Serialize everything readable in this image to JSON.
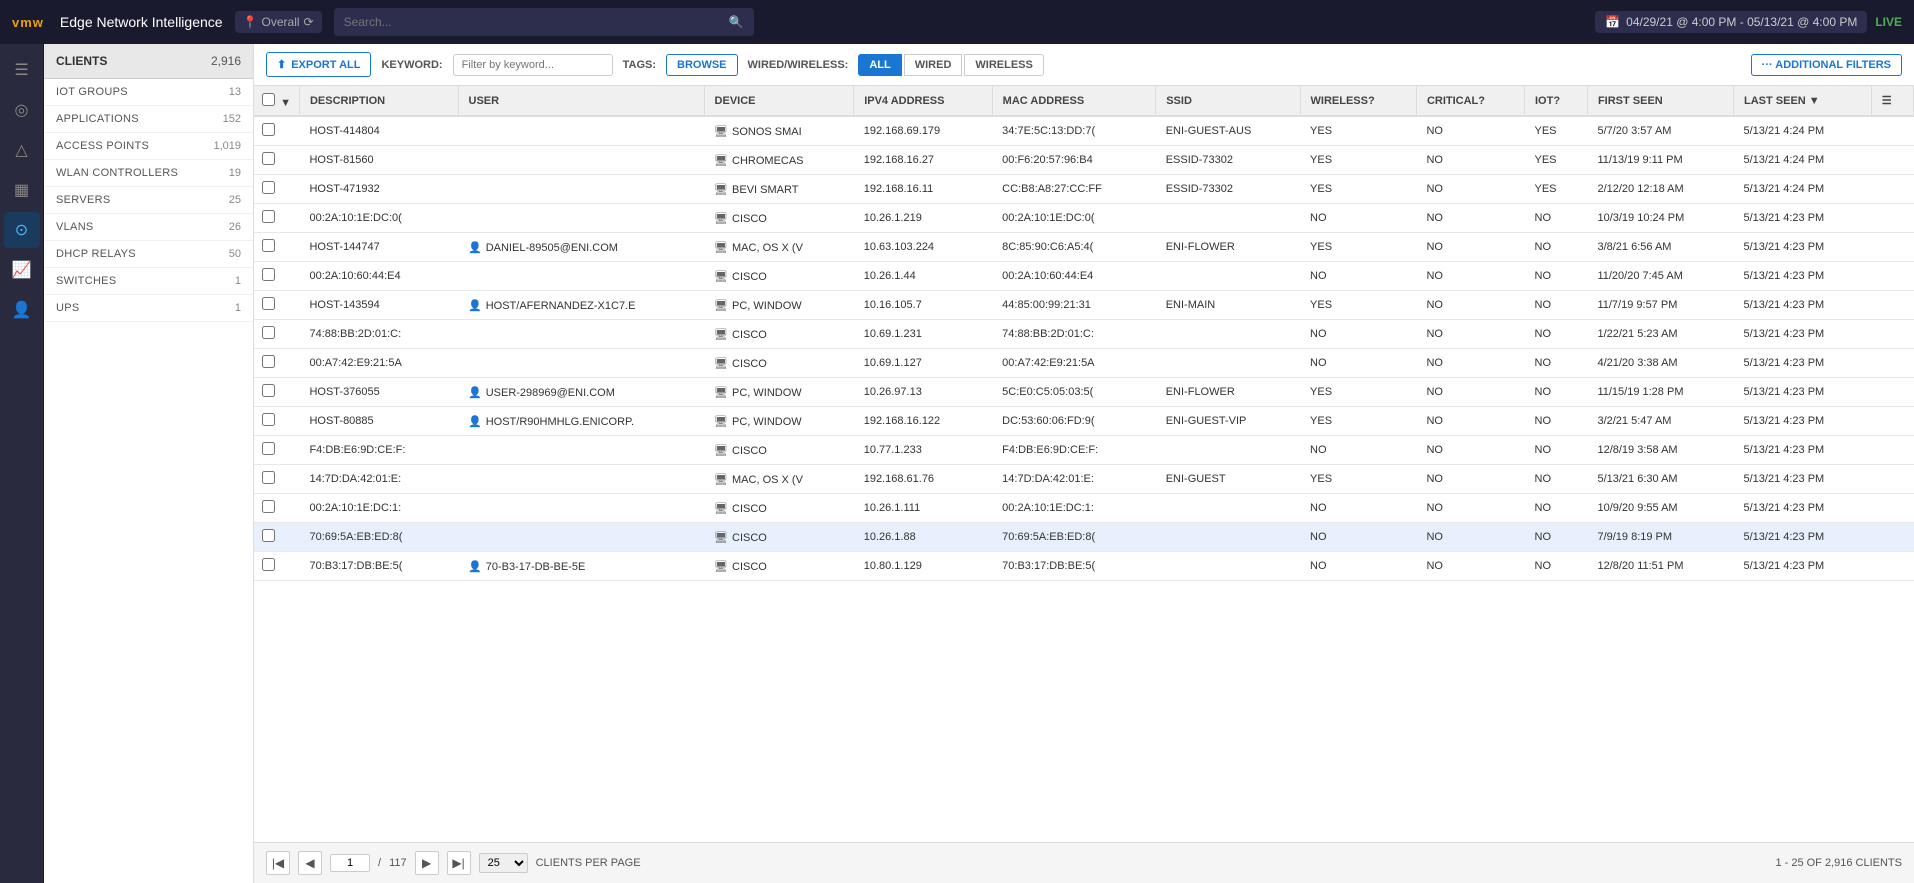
{
  "topbar": {
    "logo": "vmw",
    "title": "Edge Network Intelligence",
    "location": "Overall",
    "search_placeholder": "Search...",
    "date_range": "04/29/21 @ 4:00 PM - 05/13/21 @ 4:00 PM",
    "live_label": "LIVE"
  },
  "icon_sidebar": {
    "items": [
      {
        "name": "menu-icon",
        "symbol": "☰"
      },
      {
        "name": "location-icon",
        "symbol": "◎"
      },
      {
        "name": "alert-icon",
        "symbol": "△"
      },
      {
        "name": "chart-icon",
        "symbol": "📶"
      },
      {
        "name": "target-icon",
        "symbol": "⊙",
        "active": true
      },
      {
        "name": "analytics-icon",
        "symbol": "📈"
      },
      {
        "name": "user-icon",
        "symbol": "👤"
      },
      {
        "name": "help-icon",
        "symbol": "?"
      }
    ]
  },
  "left_panel": {
    "header": "CLIENTS",
    "total": "2,916",
    "groups": [
      {
        "label": "IOT GROUPS",
        "count": "13"
      },
      {
        "label": "APPLICATIONS",
        "count": "152"
      },
      {
        "label": "ACCESS POINTS",
        "count": "1,019"
      },
      {
        "label": "WLAN CONTROLLERS",
        "count": "19"
      },
      {
        "label": "SERVERS",
        "count": "25"
      },
      {
        "label": "VLANS",
        "count": "26"
      },
      {
        "label": "DHCP RELAYS",
        "count": "50"
      },
      {
        "label": "SWITCHES",
        "count": "1"
      },
      {
        "label": "UPS",
        "count": "1"
      }
    ]
  },
  "filter_bar": {
    "export_label": "EXPORT ALL",
    "keyword_label": "KEYWORD:",
    "keyword_placeholder": "Filter by keyword...",
    "tags_label": "TAGS:",
    "browse_label": "BROWSE",
    "wired_wireless_label": "WIRED/WIRELESS:",
    "filter_buttons": [
      "ALL",
      "WIRED",
      "WIRELESS"
    ],
    "active_filter": "ALL",
    "additional_filters_label": "··· ADDITIONAL FILTERS"
  },
  "table": {
    "columns": [
      {
        "id": "description",
        "label": "DESCRIPTION"
      },
      {
        "id": "user",
        "label": "USER"
      },
      {
        "id": "device",
        "label": "DEVICE"
      },
      {
        "id": "ipv4",
        "label": "IPV4 ADDRESS"
      },
      {
        "id": "mac",
        "label": "MAC ADDRESS"
      },
      {
        "id": "ssid",
        "label": "SSID"
      },
      {
        "id": "wireless",
        "label": "WIRELESS?"
      },
      {
        "id": "critical",
        "label": "CRITICAL?"
      },
      {
        "id": "iot",
        "label": "IOT?"
      },
      {
        "id": "first_seen",
        "label": "FIRST SEEN"
      },
      {
        "id": "last_seen",
        "label": "LAST SEEN",
        "sortable": true
      }
    ],
    "rows": [
      {
        "description": "HOST-414804",
        "user": "",
        "has_user": false,
        "device": "SONOS SMAI",
        "ipv4": "192.168.69.179",
        "mac": "34:7E:5C:13:DD:7(",
        "ssid": "ENI-GUEST-AUS",
        "wireless": "YES",
        "critical": "NO",
        "iot": "YES",
        "first_seen": "5/7/20 3:57 AM",
        "last_seen": "5/13/21 4:24 PM",
        "highlighted": false
      },
      {
        "description": "HOST-81560",
        "user": "",
        "has_user": false,
        "device": "CHROMECAS",
        "ipv4": "192.168.16.27",
        "mac": "00:F6:20:57:96:B4",
        "ssid": "ESSID-73302",
        "wireless": "YES",
        "critical": "NO",
        "iot": "YES",
        "first_seen": "11/13/19 9:11 PM",
        "last_seen": "5/13/21 4:24 PM",
        "highlighted": false
      },
      {
        "description": "HOST-471932",
        "user": "",
        "has_user": false,
        "device": "BEVI SMART",
        "ipv4": "192.168.16.11",
        "mac": "CC:B8:A8:27:CC:FF",
        "ssid": "ESSID-73302",
        "wireless": "YES",
        "critical": "NO",
        "iot": "YES",
        "first_seen": "2/12/20 12:18 AM",
        "last_seen": "5/13/21 4:24 PM",
        "highlighted": false
      },
      {
        "description": "00:2A:10:1E:DC:0(",
        "user": "",
        "has_user": false,
        "device": "CISCO",
        "ipv4": "10.26.1.219",
        "mac": "00:2A:10:1E:DC:0(",
        "ssid": "",
        "wireless": "NO",
        "critical": "NO",
        "iot": "NO",
        "first_seen": "10/3/19 10:24 PM",
        "last_seen": "5/13/21 4:23 PM",
        "highlighted": false
      },
      {
        "description": "HOST-144747",
        "user": "DANIEL-89505@ENI.COM",
        "has_user": true,
        "device": "MAC, OS X (V",
        "ipv4": "10.63.103.224",
        "mac": "8C:85:90:C6:A5:4(",
        "ssid": "ENI-FLOWER",
        "wireless": "YES",
        "critical": "NO",
        "iot": "NO",
        "first_seen": "3/8/21 6:56 AM",
        "last_seen": "5/13/21 4:23 PM",
        "highlighted": false
      },
      {
        "description": "00:2A:10:60:44:E4",
        "user": "",
        "has_user": false,
        "device": "CISCO",
        "ipv4": "10.26.1.44",
        "mac": "00:2A:10:60:44:E4",
        "ssid": "",
        "wireless": "NO",
        "critical": "NO",
        "iot": "NO",
        "first_seen": "11/20/20 7:45 AM",
        "last_seen": "5/13/21 4:23 PM",
        "highlighted": false
      },
      {
        "description": "HOST-143594",
        "user": "HOST/AFERNANDEZ-X1C7.E",
        "has_user": true,
        "device": "PC, WINDOW",
        "ipv4": "10.16.105.7",
        "mac": "44:85:00:99:21:31",
        "ssid": "ENI-MAIN",
        "wireless": "YES",
        "critical": "NO",
        "iot": "NO",
        "first_seen": "11/7/19 9:57 PM",
        "last_seen": "5/13/21 4:23 PM",
        "highlighted": false
      },
      {
        "description": "74:88:BB:2D:01:C:",
        "user": "",
        "has_user": false,
        "device": "CISCO",
        "ipv4": "10.69.1.231",
        "mac": "74:88:BB:2D:01:C:",
        "ssid": "",
        "wireless": "NO",
        "critical": "NO",
        "iot": "NO",
        "first_seen": "1/22/21 5:23 AM",
        "last_seen": "5/13/21 4:23 PM",
        "highlighted": false
      },
      {
        "description": "00:A7:42:E9:21:5A",
        "user": "",
        "has_user": false,
        "device": "CISCO",
        "ipv4": "10.69.1.127",
        "mac": "00:A7:42:E9:21:5A",
        "ssid": "",
        "wireless": "NO",
        "critical": "NO",
        "iot": "NO",
        "first_seen": "4/21/20 3:38 AM",
        "last_seen": "5/13/21 4:23 PM",
        "highlighted": false
      },
      {
        "description": "HOST-376055",
        "user": "USER-298969@ENI.COM",
        "has_user": true,
        "device": "PC, WINDOW",
        "ipv4": "10.26.97.13",
        "mac": "5C:E0:C5:05:03:5(",
        "ssid": "ENI-FLOWER",
        "wireless": "YES",
        "critical": "NO",
        "iot": "NO",
        "first_seen": "11/15/19 1:28 PM",
        "last_seen": "5/13/21 4:23 PM",
        "highlighted": false
      },
      {
        "description": "HOST-80885",
        "user": "HOST/R90HMHLG.ENICORP.",
        "has_user": true,
        "device": "PC, WINDOW",
        "ipv4": "192.168.16.122",
        "mac": "DC:53:60:06:FD:9(",
        "ssid": "ENI-GUEST-VIP",
        "wireless": "YES",
        "critical": "NO",
        "iot": "NO",
        "first_seen": "3/2/21 5:47 AM",
        "last_seen": "5/13/21 4:23 PM",
        "highlighted": false
      },
      {
        "description": "F4:DB:E6:9D:CE:F:",
        "user": "",
        "has_user": false,
        "device": "CISCO",
        "ipv4": "10.77.1.233",
        "mac": "F4:DB:E6:9D:CE:F:",
        "ssid": "",
        "wireless": "NO",
        "critical": "NO",
        "iot": "NO",
        "first_seen": "12/8/19 3:58 AM",
        "last_seen": "5/13/21 4:23 PM",
        "highlighted": false
      },
      {
        "description": "14:7D:DA:42:01:E:",
        "user": "",
        "has_user": false,
        "device": "MAC, OS X (V",
        "ipv4": "192.168.61.76",
        "mac": "14:7D:DA:42:01:E:",
        "ssid": "ENI-GUEST",
        "wireless": "YES",
        "critical": "NO",
        "iot": "NO",
        "first_seen": "5/13/21 6:30 AM",
        "last_seen": "5/13/21 4:23 PM",
        "highlighted": false
      },
      {
        "description": "00:2A:10:1E:DC:1:",
        "user": "",
        "has_user": false,
        "device": "CISCO",
        "ipv4": "10.26.1.111",
        "mac": "00:2A:10:1E:DC:1:",
        "ssid": "",
        "wireless": "NO",
        "critical": "NO",
        "iot": "NO",
        "first_seen": "10/9/20 9:55 AM",
        "last_seen": "5/13/21 4:23 PM",
        "highlighted": false
      },
      {
        "description": "70:69:5A:EB:ED:8(",
        "user": "",
        "has_user": false,
        "device": "CISCO",
        "ipv4": "10.26.1.88",
        "mac": "70:69:5A:EB:ED:8(",
        "ssid": "",
        "wireless": "NO",
        "critical": "NO",
        "iot": "NO",
        "first_seen": "7/9/19 8:19 PM",
        "last_seen": "5/13/21 4:23 PM",
        "highlighted": true
      },
      {
        "description": "70:B3:17:DB:BE:5(",
        "user": "70-B3-17-DB-BE-5E",
        "has_user": true,
        "device": "CISCO",
        "ipv4": "10.80.1.129",
        "mac": "70:B3:17:DB:BE:5(",
        "ssid": "",
        "wireless": "NO",
        "critical": "NO",
        "iot": "NO",
        "first_seen": "12/8/20 11:51 PM",
        "last_seen": "5/13/21 4:23 PM",
        "highlighted": false
      }
    ]
  },
  "footer": {
    "page_label": "1",
    "total_pages": "117",
    "per_page": "25",
    "per_page_label": "CLIENTS PER PAGE",
    "total_label": "1 - 25 OF 2,916 CLIENTS"
  }
}
